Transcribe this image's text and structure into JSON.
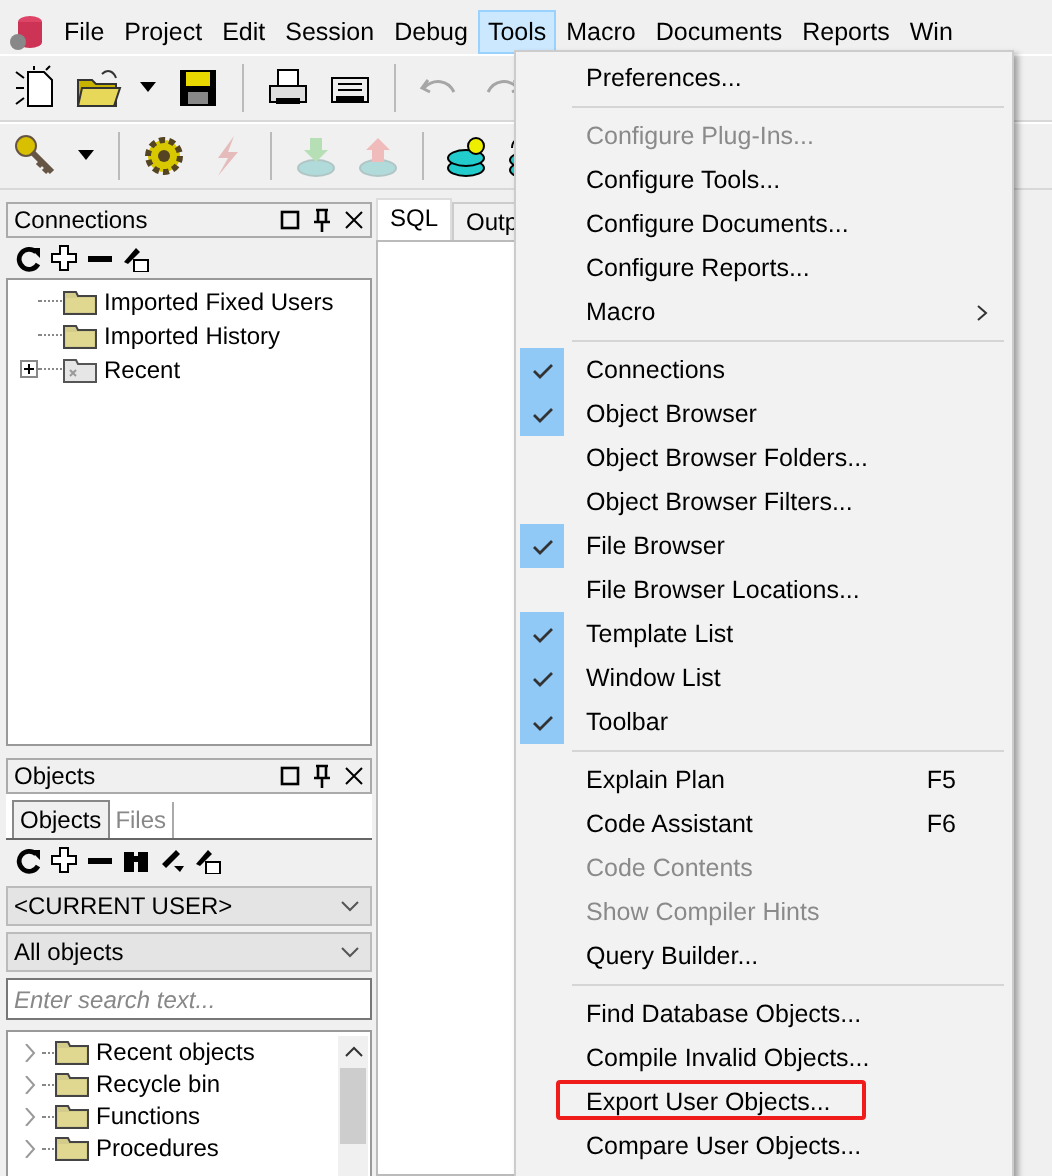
{
  "menubar": [
    {
      "label": "File",
      "selected": false
    },
    {
      "label": "Project",
      "selected": false
    },
    {
      "label": "Edit",
      "selected": false
    },
    {
      "label": "Session",
      "selected": false
    },
    {
      "label": "Debug",
      "selected": false
    },
    {
      "label": "Tools",
      "selected": true
    },
    {
      "label": "Macro",
      "selected": false
    },
    {
      "label": "Documents",
      "selected": false
    },
    {
      "label": "Reports",
      "selected": false
    },
    {
      "label": "Win",
      "selected": false
    }
  ],
  "toolbars": [
    {
      "buttons": [
        {
          "kind": "new-file",
          "disabled": false
        },
        {
          "kind": "open",
          "disabled": false
        },
        {
          "kind": "caret",
          "disabled": false
        },
        {
          "kind": "save",
          "disabled": false
        },
        {
          "kind": "sep"
        },
        {
          "kind": "print",
          "disabled": false
        },
        {
          "kind": "printer",
          "disabled": false
        },
        {
          "kind": "sep"
        },
        {
          "kind": "undo",
          "disabled": true
        },
        {
          "kind": "redo",
          "disabled": true
        }
      ]
    },
    {
      "buttons": [
        {
          "kind": "key",
          "disabled": false
        },
        {
          "kind": "caret",
          "disabled": false
        },
        {
          "kind": "sep"
        },
        {
          "kind": "gear",
          "disabled": false
        },
        {
          "kind": "bolt",
          "disabled": true
        },
        {
          "kind": "sep"
        },
        {
          "kind": "down",
          "disabled": true
        },
        {
          "kind": "up",
          "disabled": true
        },
        {
          "kind": "sep"
        },
        {
          "kind": "db",
          "disabled": false
        },
        {
          "kind": "sqldb",
          "disabled": false
        }
      ]
    }
  ],
  "connections": {
    "title": "Connections",
    "tree": [
      {
        "label": "Imported Fixed Users",
        "kind": "folder"
      },
      {
        "label": "Imported History",
        "kind": "folder"
      },
      {
        "label": "Recent",
        "kind": "recent",
        "expanded": false
      }
    ]
  },
  "objects": {
    "title": "Objects",
    "tabs": [
      {
        "label": "Objects",
        "selected": true
      },
      {
        "label": "Files",
        "selected": false
      }
    ],
    "user": "<CURRENT USER>",
    "filter": "All objects",
    "search": {
      "placeholder": "Enter search text..."
    },
    "tree": [
      {
        "label": "Recent objects",
        "expanded": false
      },
      {
        "label": "Recycle bin",
        "expanded": false
      },
      {
        "label": "Functions",
        "expanded": false
      },
      {
        "label": "Procedures",
        "expanded": false
      }
    ]
  },
  "editor_tabs": [
    {
      "label": "SQL",
      "selected": true
    },
    {
      "label": "Outp",
      "selected": false
    }
  ],
  "tools_menu": [
    {
      "kind": "item",
      "label": "Preferences...",
      "checked": false,
      "disabled": false,
      "highlighted": false
    },
    {
      "kind": "separator"
    },
    {
      "kind": "item",
      "label": "Configure Plug-Ins...",
      "checked": false,
      "disabled": true,
      "highlighted": false
    },
    {
      "kind": "item",
      "label": "Configure Tools...",
      "checked": false,
      "disabled": false,
      "highlighted": false
    },
    {
      "kind": "item",
      "label": "Configure Documents...",
      "checked": false,
      "disabled": false,
      "highlighted": false
    },
    {
      "kind": "item",
      "label": "Configure Reports...",
      "checked": false,
      "disabled": false,
      "highlighted": false
    },
    {
      "kind": "submenu",
      "label": "Macro",
      "checked": false,
      "disabled": false,
      "highlighted": false
    },
    {
      "kind": "separator"
    },
    {
      "kind": "item",
      "label": "Connections",
      "checked": true,
      "disabled": false,
      "highlighted": false
    },
    {
      "kind": "item",
      "label": "Object Browser",
      "checked": true,
      "disabled": false,
      "highlighted": false
    },
    {
      "kind": "item",
      "label": "Object Browser Folders...",
      "checked": false,
      "disabled": false,
      "highlighted": false
    },
    {
      "kind": "item",
      "label": "Object Browser Filters...",
      "checked": false,
      "disabled": false,
      "highlighted": false
    },
    {
      "kind": "item",
      "label": "File Browser",
      "checked": true,
      "disabled": false,
      "highlighted": false
    },
    {
      "kind": "item",
      "label": "File Browser Locations...",
      "checked": false,
      "disabled": false,
      "highlighted": false
    },
    {
      "kind": "item",
      "label": "Template List",
      "checked": true,
      "disabled": false,
      "highlighted": false
    },
    {
      "kind": "item",
      "label": "Window List",
      "checked": true,
      "disabled": false,
      "highlighted": false
    },
    {
      "kind": "item",
      "label": "Toolbar",
      "checked": true,
      "disabled": false,
      "highlighted": false
    },
    {
      "kind": "separator"
    },
    {
      "kind": "item",
      "label": "Explain Plan",
      "shortcut": "F5",
      "checked": false,
      "disabled": false,
      "highlighted": false
    },
    {
      "kind": "item",
      "label": "Code Assistant",
      "shortcut": "F6",
      "checked": false,
      "disabled": false,
      "highlighted": false
    },
    {
      "kind": "item",
      "label": "Code Contents",
      "checked": false,
      "disabled": true,
      "highlighted": false
    },
    {
      "kind": "item",
      "label": "Show Compiler Hints",
      "checked": false,
      "disabled": true,
      "highlighted": false
    },
    {
      "kind": "item",
      "label": "Query Builder...",
      "checked": false,
      "disabled": false,
      "highlighted": false
    },
    {
      "kind": "separator"
    },
    {
      "kind": "item",
      "label": "Find Database Objects...",
      "checked": false,
      "disabled": false,
      "highlighted": false
    },
    {
      "kind": "item",
      "label": "Compile Invalid Objects...",
      "checked": false,
      "disabled": false,
      "highlighted": false
    },
    {
      "kind": "item",
      "label": "Export User Objects...",
      "checked": false,
      "disabled": false,
      "highlighted": true
    },
    {
      "kind": "item",
      "label": "Compare User Objects...",
      "checked": false,
      "disabled": false,
      "highlighted": false
    }
  ]
}
